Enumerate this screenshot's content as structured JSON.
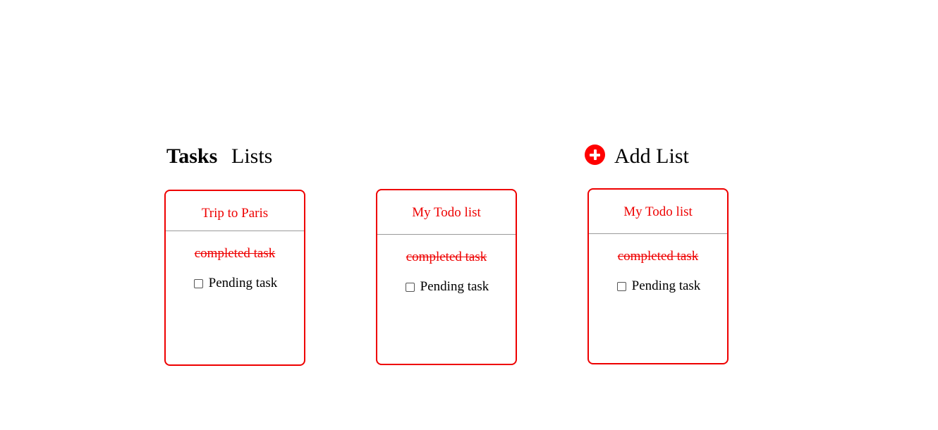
{
  "nav": {
    "tasks_label": "Tasks",
    "lists_label": "Lists",
    "add_list_label": "Add List"
  },
  "colors": {
    "accent": "#ee0000",
    "divider": "#9a9a9a"
  },
  "lists": [
    {
      "title": "Trip to Paris",
      "tasks": [
        {
          "text": "completed task",
          "completed": true
        },
        {
          "text": "Pending task",
          "completed": false
        }
      ]
    },
    {
      "title": "My Todo list",
      "tasks": [
        {
          "text": "completed task",
          "completed": true
        },
        {
          "text": "Pending task",
          "completed": false
        }
      ]
    },
    {
      "title": "My Todo list",
      "tasks": [
        {
          "text": "completed task",
          "completed": true
        },
        {
          "text": "Pending task",
          "completed": false
        }
      ]
    }
  ]
}
